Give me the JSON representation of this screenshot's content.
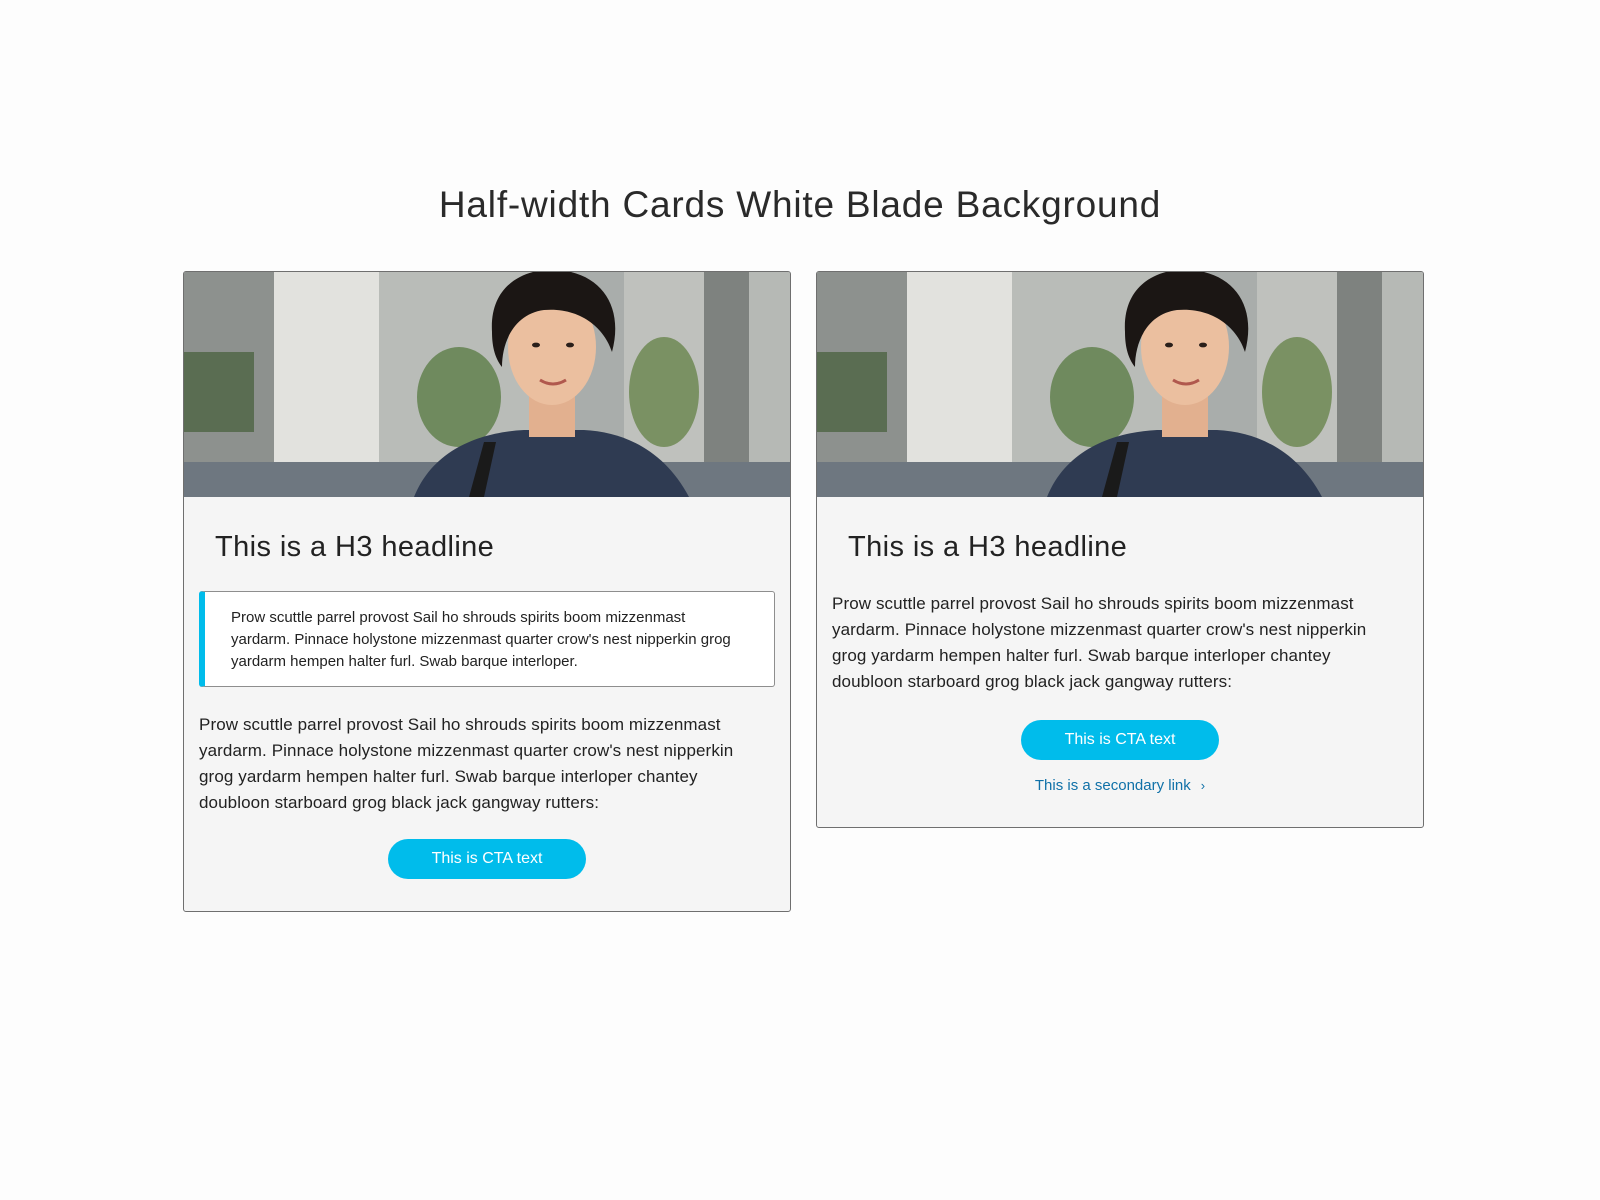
{
  "blade": {
    "title": "Half-width Cards White Blade Background"
  },
  "cards": [
    {
      "image_alt": "woman-portrait-photo",
      "headline": "This is a H3 headline",
      "callout": "Prow scuttle parrel provost Sail ho shrouds spirits boom mizzenmast yardarm. Pinnace holystone mizzenmast quarter crow's nest nipperkin grog yardarm hempen halter furl. Swab barque interloper.",
      "body": "Prow scuttle parrel provost Sail ho shrouds spirits boom mizzenmast yardarm. Pinnace holystone mizzenmast quarter crow's nest nipperkin grog yardarm hempen halter furl. Swab barque interloper chantey doubloon starboard grog black jack gangway rutters:",
      "cta": "This is CTA text"
    },
    {
      "image_alt": "woman-portrait-photo",
      "headline": "This is a H3 headline",
      "body": "Prow scuttle parrel provost Sail ho shrouds spirits boom mizzenmast yardarm. Pinnace holystone mizzenmast quarter crow's nest nipperkin grog yardarm hempen halter furl. Swab barque interloper chantey doubloon starboard grog black jack gangway rutters:",
      "cta": "This is CTA text",
      "secondary_link": "This is a secondary link",
      "secondary_icon": "chevron-right-icon"
    }
  ],
  "colors": {
    "accent": "#00bceb",
    "link": "#1071a8",
    "card_bg": "#f5f5f5",
    "page_bg": "#fdfdfd"
  }
}
